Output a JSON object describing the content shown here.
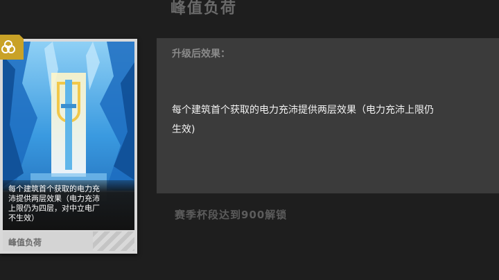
{
  "page": {
    "title": "峰值负荷"
  },
  "effect": {
    "heading": "升级后效果：",
    "description": "每个建筑首个获取的电力充沛提供两层效果（电力充沛上限仍\n生效)"
  },
  "unlock": {
    "text": "赛季杯段达到900解锁"
  },
  "card": {
    "description": "每个建筑首个获取的电力充\n沛提供两层效果（电力充沛\n上限仍为四层，对中立电厂\n不生效）",
    "name": "峰值负荷",
    "badge_icon": "triple-circle-icon"
  },
  "colors": {
    "panel_bg": "#3b3b3b",
    "page_bg": "#1e1e1e",
    "badge_gold": "#c9a227"
  }
}
